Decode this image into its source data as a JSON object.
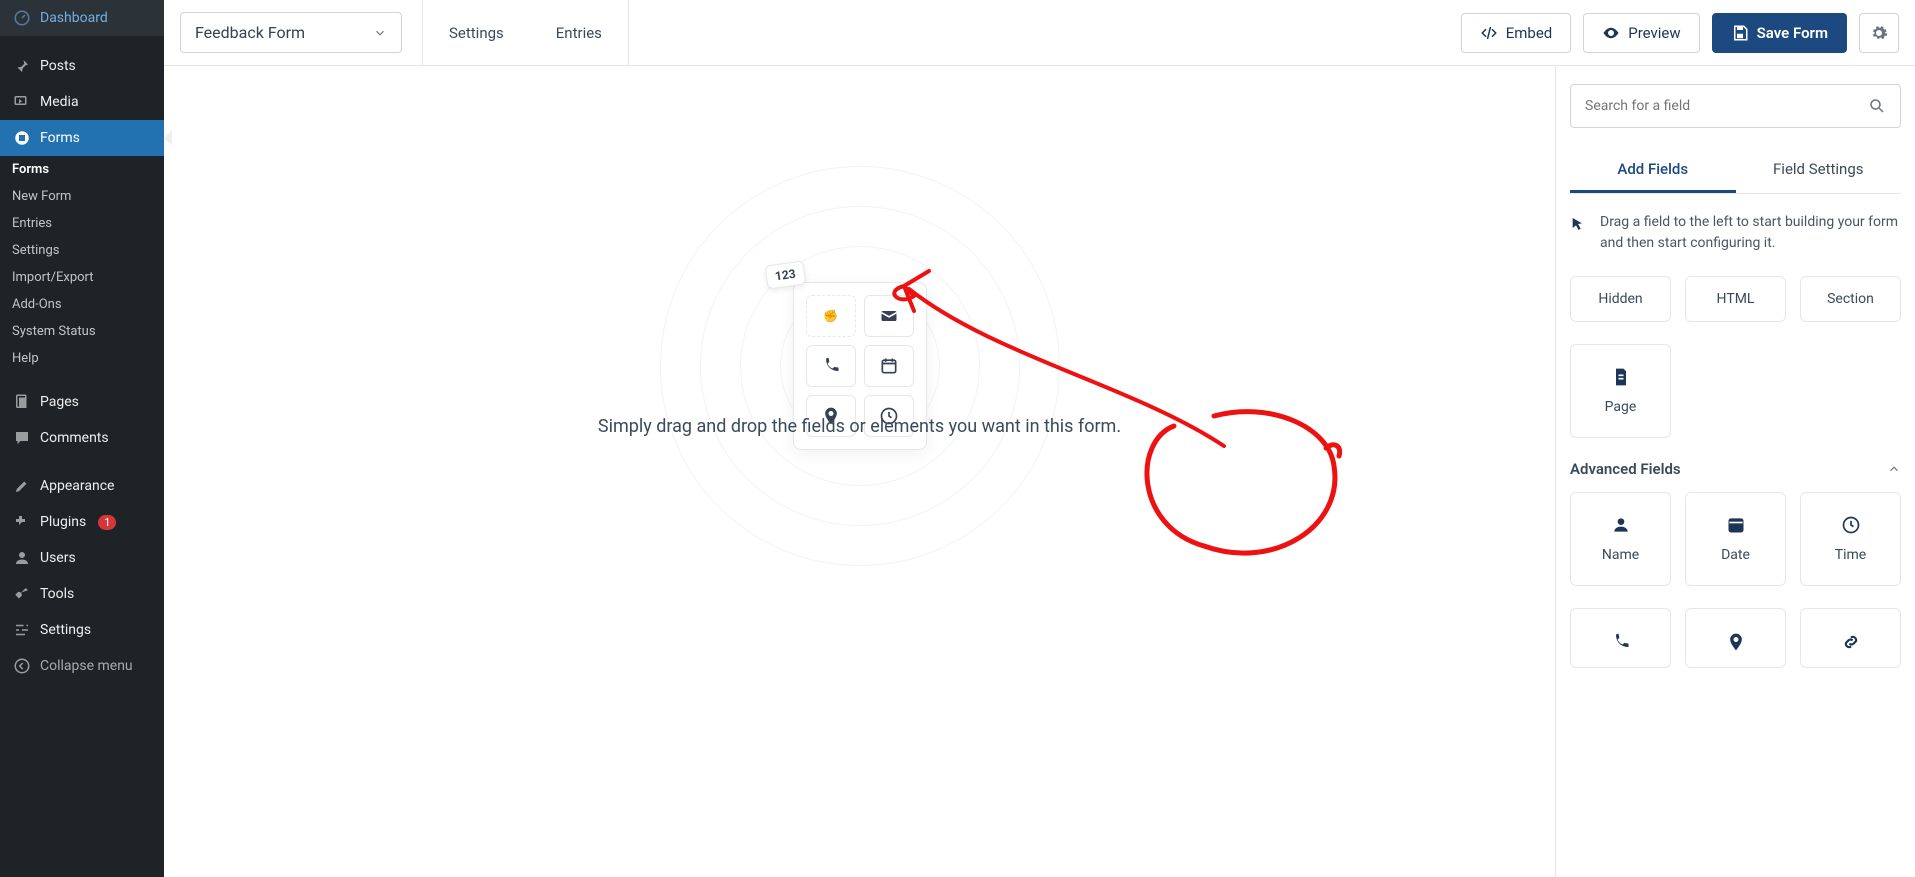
{
  "sidebar": {
    "dashboard": "Dashboard",
    "posts": "Posts",
    "media": "Media",
    "forms": "Forms",
    "sub": {
      "forms": "Forms",
      "newform": "New Form",
      "entries": "Entries",
      "settings": "Settings",
      "importexport": "Import/Export",
      "addons": "Add-Ons",
      "systemstatus": "System Status",
      "help": "Help"
    },
    "pages": "Pages",
    "comments": "Comments",
    "appearance": "Appearance",
    "plugins": "Plugins",
    "plugins_count": "1",
    "users": "Users",
    "tools": "Tools",
    "settings": "Settings",
    "collapse": "Collapse menu"
  },
  "topbar": {
    "form_select": "Feedback Form",
    "settings": "Settings",
    "entries": "Entries",
    "embed": "Embed",
    "preview": "Preview",
    "save": "Save Form"
  },
  "canvas": {
    "chip": "123",
    "instruction": "Simply drag and drop the fields or elements you want in this form."
  },
  "right": {
    "search_placeholder": "Search for a field",
    "tab_add": "Add Fields",
    "tab_settings": "Field Settings",
    "hint": "Drag a field to the left to start building your form and then start configuring it.",
    "row1": {
      "hidden": "Hidden",
      "html": "HTML",
      "section": "Section"
    },
    "page": "Page",
    "advanced_head": "Advanced Fields",
    "adv": {
      "name": "Name",
      "date": "Date",
      "time": "Time"
    }
  }
}
